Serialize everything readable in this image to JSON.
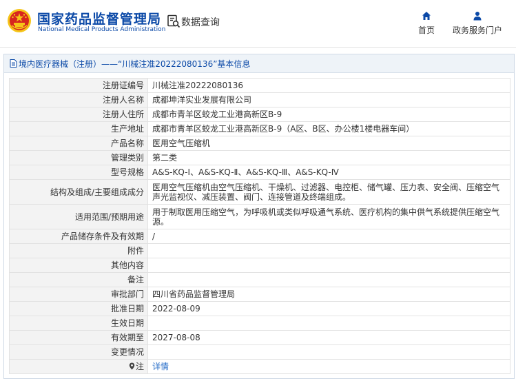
{
  "header": {
    "brand_cn": "国家药品监督管理局",
    "brand_en": "National Medical Products Administration",
    "search_label": "数据查询",
    "nav": [
      {
        "label": "首页",
        "icon": "home-icon"
      },
      {
        "label": "政务服务门户",
        "icon": "user-icon"
      }
    ]
  },
  "panel": {
    "title": "境内医疗器械（注册）——“川械注准20222080136”基本信息"
  },
  "rows": [
    {
      "key": "注册证编号",
      "value": "川械注准20222080136"
    },
    {
      "key": "注册人名称",
      "value": "成都坤洋实业发展有限公司"
    },
    {
      "key": "注册人住所",
      "value": "成都市青羊区蛟龙工业港高新区B-9"
    },
    {
      "key": "生产地址",
      "value": "成都市青羊区蛟龙工业港高新区B-9（A区、B区、办公楼1楼电器车间）"
    },
    {
      "key": "产品名称",
      "value": "医用空气压缩机"
    },
    {
      "key": "管理类别",
      "value": "第二类"
    },
    {
      "key": "型号规格",
      "value": "A&S-KQ-Ⅰ、A&S-KQ-Ⅱ、A&S-KQ-Ⅲ、A&S-KQ-Ⅳ"
    },
    {
      "key": "结构及组成/主要组成成分",
      "value": "医用空气压缩机由空气压缩机、干燥机、过滤器、电控柜、储气罐、压力表、安全阀、压缩空气声光监视仪、减压装置、阀门、连接管道及终端组成。"
    },
    {
      "key": "适用范围/预期用途",
      "value": "用于制取医用压缩空气，为呼吸机或类似呼吸通气系统、医疗机构的集中供气系统提供压缩空气源。"
    },
    {
      "key": "产品储存条件及有效期",
      "value": "/"
    },
    {
      "key": "附件",
      "value": ""
    },
    {
      "key": "其他内容",
      "value": ""
    },
    {
      "key": "备注",
      "value": ""
    },
    {
      "key": "审批部门",
      "value": "四川省药品监督管理局"
    },
    {
      "key": "批准日期",
      "value": "2022-08-09"
    },
    {
      "key": "生效日期",
      "value": ""
    },
    {
      "key": "有效期至",
      "value": "2027-08-08"
    },
    {
      "key": "变更情况",
      "value": ""
    },
    {
      "key": "注",
      "value": "详情"
    }
  ],
  "colors": {
    "brand": "#0b49a7",
    "link": "#2a6fc9",
    "emblem_red": "#d7261f",
    "emblem_gold": "#f5c518"
  }
}
